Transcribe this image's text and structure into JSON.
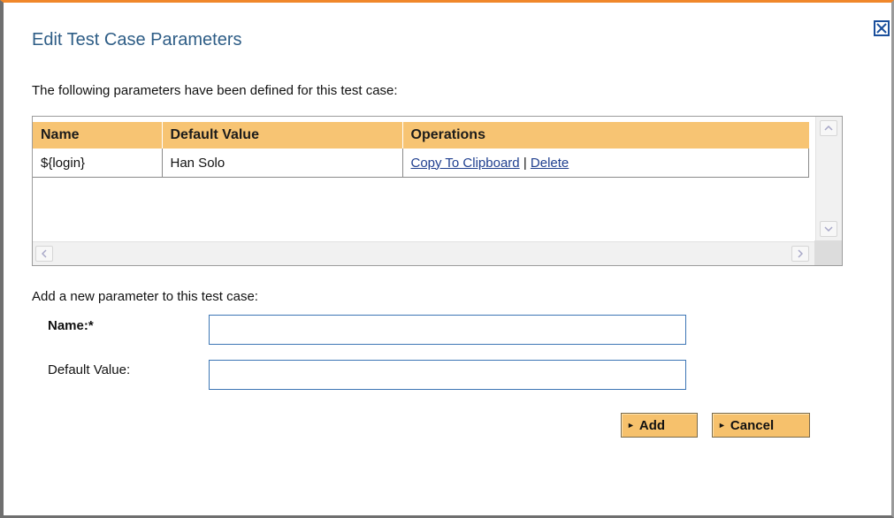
{
  "dialog": {
    "title": "Edit Test Case Parameters",
    "intro": "The following parameters have been defined for this test case:",
    "close_icon": "close-x-icon"
  },
  "table": {
    "headers": [
      "Name",
      "Default Value",
      "Operations"
    ],
    "rows": [
      {
        "name": "${login}",
        "default_value": "Han Solo",
        "operations": {
          "copy_label": "Copy To Clipboard",
          "separator": "|",
          "delete_label": "Delete"
        }
      }
    ]
  },
  "form": {
    "caption": "Add a new parameter to this test case:",
    "name_label": "Name:*",
    "name_value": "",
    "default_label": "Default Value:",
    "default_value": ""
  },
  "buttons": {
    "add_label": "Add",
    "cancel_label": "Cancel",
    "bullet": "►"
  },
  "colors": {
    "title": "#2e5d86",
    "header_bg": "#f7c473",
    "button_bg": "#f6c16c",
    "link": "#1f3f8f",
    "dialog_top_border": "#f0872a"
  }
}
